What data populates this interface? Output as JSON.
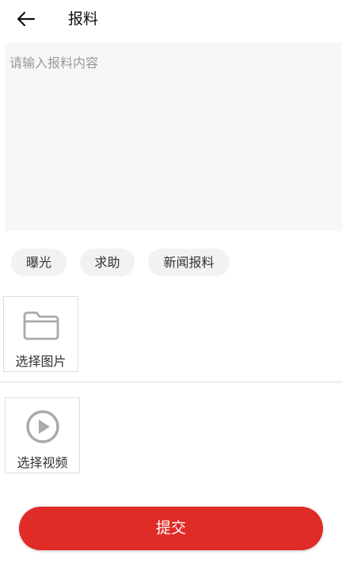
{
  "header": {
    "title": "报料",
    "back_icon": "arrow-left-icon"
  },
  "content": {
    "value": "",
    "placeholder": "请输入报料内容"
  },
  "categories": [
    {
      "label": "曝光"
    },
    {
      "label": "求助"
    },
    {
      "label": "新闻报料"
    }
  ],
  "media": {
    "image_picker": {
      "label": "选择图片",
      "icon": "folder-icon"
    },
    "video_picker": {
      "label": "选择视频",
      "icon": "play-circle-icon"
    }
  },
  "submit": {
    "label": "提交"
  },
  "colors": {
    "accent": "#e02b26",
    "chip_bg": "#f2f2f2",
    "input_bg": "#f7f7f7",
    "icon_gray": "#aaaaaa"
  }
}
